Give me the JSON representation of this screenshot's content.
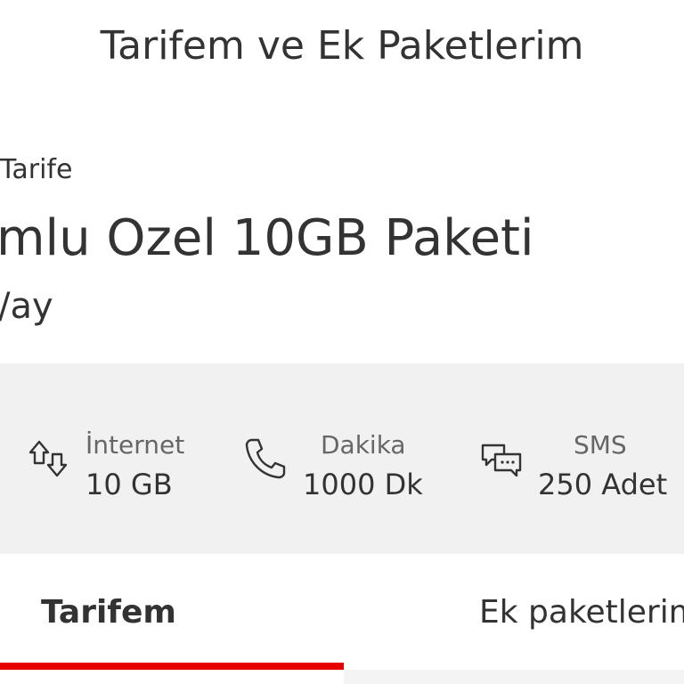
{
  "header": {
    "title": "Tarifem ve Ek Paketlerim"
  },
  "tariff": {
    "label": "Tarife",
    "name": "mlu Ozel 10GB Paketi",
    "price": "/ay"
  },
  "allowances": {
    "internet": {
      "label": "İnternet",
      "value": "10 GB",
      "icon": "data-transfer-icon"
    },
    "minutes": {
      "label": "Dakika",
      "value": "1000 Dk",
      "icon": "phone-icon"
    },
    "sms": {
      "label": "SMS",
      "value": "250 Adet",
      "icon": "chat-bubbles-icon"
    }
  },
  "tabs": [
    {
      "label": "Tarifem",
      "active": true
    },
    {
      "label": "Ek paketlerim",
      "active": false
    }
  ],
  "colors": {
    "accent": "#e60000",
    "panel_bg": "#f1f1f1",
    "text": "#333333",
    "muted": "#666666"
  }
}
